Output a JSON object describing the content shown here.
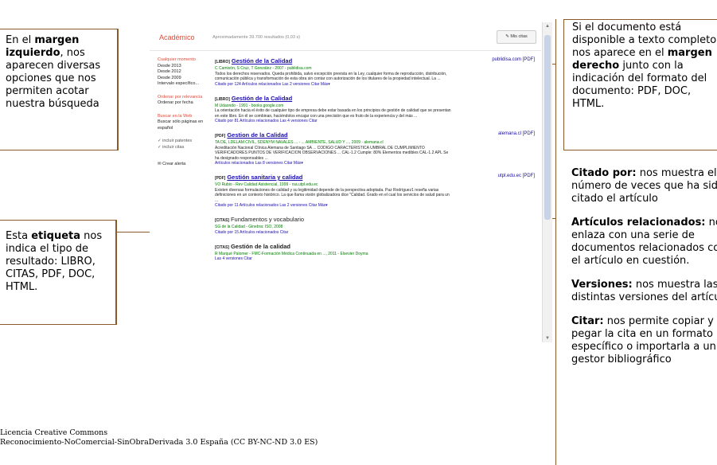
{
  "callouts": {
    "left1": {
      "pre": "En el ",
      "bold": "margen izquierdo",
      "post": ", nos aparecen diversas opciones que nos permiten acotar nuestra búsqueda"
    },
    "left2": {
      "pre": "Esta ",
      "bold": "etiqueta",
      "post": " nos indica el tipo de resultado: LIBRO, CITAS, PDF, DOC, HTML."
    },
    "right_top": {
      "pre": "Si el documento está disponible a texto completo, nos aparece en el ",
      "bold": "margen derecho",
      "post": " junto con la indicación del formato del documento: PDF, DOC, HTML."
    },
    "right_items": [
      {
        "bold": "Citado por:",
        "text": " nos muestra el número de veces que ha sido citado el artículo"
      },
      {
        "bold": "Artículos relacionados:",
        "text": " nos enlaza con una serie de documentos relacionados con el artículo en cuestión."
      },
      {
        "bold": "Versiones:",
        "text": " nos muestra las distintas versiones del artículo"
      },
      {
        "bold": "Citar:",
        "text": " nos permite copiar y pegar la cita en un formato específico o importarla a un gestor bibliográfico"
      }
    ]
  },
  "footer": {
    "line1": "Licencia Creative Commons",
    "line2": "Reconocimiento-NoComercial-SinObraDerivada 3.0 España (CC BY-NC-ND 3.0 ES)"
  },
  "scholar": {
    "brand": "Académico",
    "count": "Aproximadamente 39.700 resultados (0,03 s)",
    "my_cites": "Mis citas",
    "sidebar": {
      "time": [
        "Cualquier momento",
        "Desde 2013",
        "Desde 2012",
        "Desde 2009",
        "Intervalo específico..."
      ],
      "sort": [
        "Ordenar por relevancia",
        "Ordenar por fecha"
      ],
      "lang": [
        "Buscar en la Web",
        "Buscar sólo páginas en español"
      ],
      "checks": [
        "incluir patentes",
        "incluir citas"
      ],
      "alert": "Crear alerta"
    },
    "results": [
      {
        "tag": "[LIBRO]",
        "title": "Gestión de la Calidad",
        "meta": "C Camisón, S Cruz, T González - 2007 - publidisa.com",
        "snippet": "Todos los derechos reservados. Queda prohibida, salvo excepción prevista en la Ley, cualquier forma de reproducción, distribución, comunicación pública y transformación de esta obra sin contar con autorización de los titulares de la propiedad intelectual. La ...",
        "links": "Citado por 124   Artículos relacionados   Las 2 versiones   Citar   Más▾",
        "side": "publidisa.com [PDF]"
      },
      {
        "tag": "[LIBRO]",
        "title": "Gestión de la Calidad",
        "meta": "M Udaondo - 1991 - books.google.com",
        "snippet": "La orientación hacia el éxito de cualquier tipo de empresa debe estar basada en los principios de gestión de calidad que se presentan en este libro. En él se combinan, haciéndolos encajar con una precisión que es fruto de la experiencia y del más ...",
        "links": "Citado por 81   Artículos relacionados   Las 4 versiones   Citar",
        "side": ""
      },
      {
        "tag": "[PDF]",
        "title": "Gestion de la Calidad",
        "meta": "TA DE, LDELAM CIVIL, SDENYM NAVALES ... - ... AMBIENTE, SALUD Y ..., 2009 - alemana.cl",
        "snippet": "Acreditación Nacional Clínica Alemana de Santiago SA ... CODIGO CARACTERISTICA UMBRAL DE CUMPLIMIENTO VERIFICADORES PUNTOS DE VERIFICACION OBSERVACIONES ... CAL-1.2 Cumple: 80% Elementos medibles CAL-1.2 APL Se ha designado responsables ...",
        "links": "Artículos relacionados   Las 8 versiones   Citar   Más▾",
        "side": "alemana.cl [PDF]"
      },
      {
        "tag": "[PDF]",
        "title": "Gestión sanitaria y calidad",
        "meta": "VO Rubio - Rev Calidad Asistencial, 1999 - rsa.utpl.edu.ec",
        "snippet": "Existen diversas formulaciones de calidad y su legitimidad depende de la perspectiva adoptada. Paz Rodríguez1 reseña varias definiciones en un contexto histórico. La que llama visión globalizadora dice \"Calidad. Grado en el cual los servicios de salud para un ...",
        "links": "Citado por 11   Artículos relacionados   Las 2 versiones   Citar   Más▾",
        "side": "utpl.edu.ec [PDF]"
      },
      {
        "tag": "[CITAS]",
        "title": "Fundamentos y vocabulario",
        "meta": "SG de la Calidad - Ginebra: ISO, 2008",
        "snippet": "",
        "links": "Citado por 15   Artículos relacionados   Citar",
        "side": ""
      },
      {
        "tag": "[CITAS]",
        "title": "Gestión de la calidad",
        "meta": "R Marqué Palomer - FMC-Formación Médica Continuada en ..., 2011 - Elsevier Doyma",
        "snippet": "",
        "links": "Las 4 versiones   Citar",
        "side": ""
      }
    ]
  },
  "colors": {
    "border": "#8b5a2b",
    "scholar_red": "#dd4b39",
    "link_blue": "#1a0dab",
    "meta_green": "#008000"
  },
  "icons": {
    "pencil": "pencil-icon",
    "mail": "mail-icon",
    "check": "checkmark-icon",
    "scroll_up": "arrow-up-icon",
    "scroll_down": "arrow-down-icon"
  }
}
